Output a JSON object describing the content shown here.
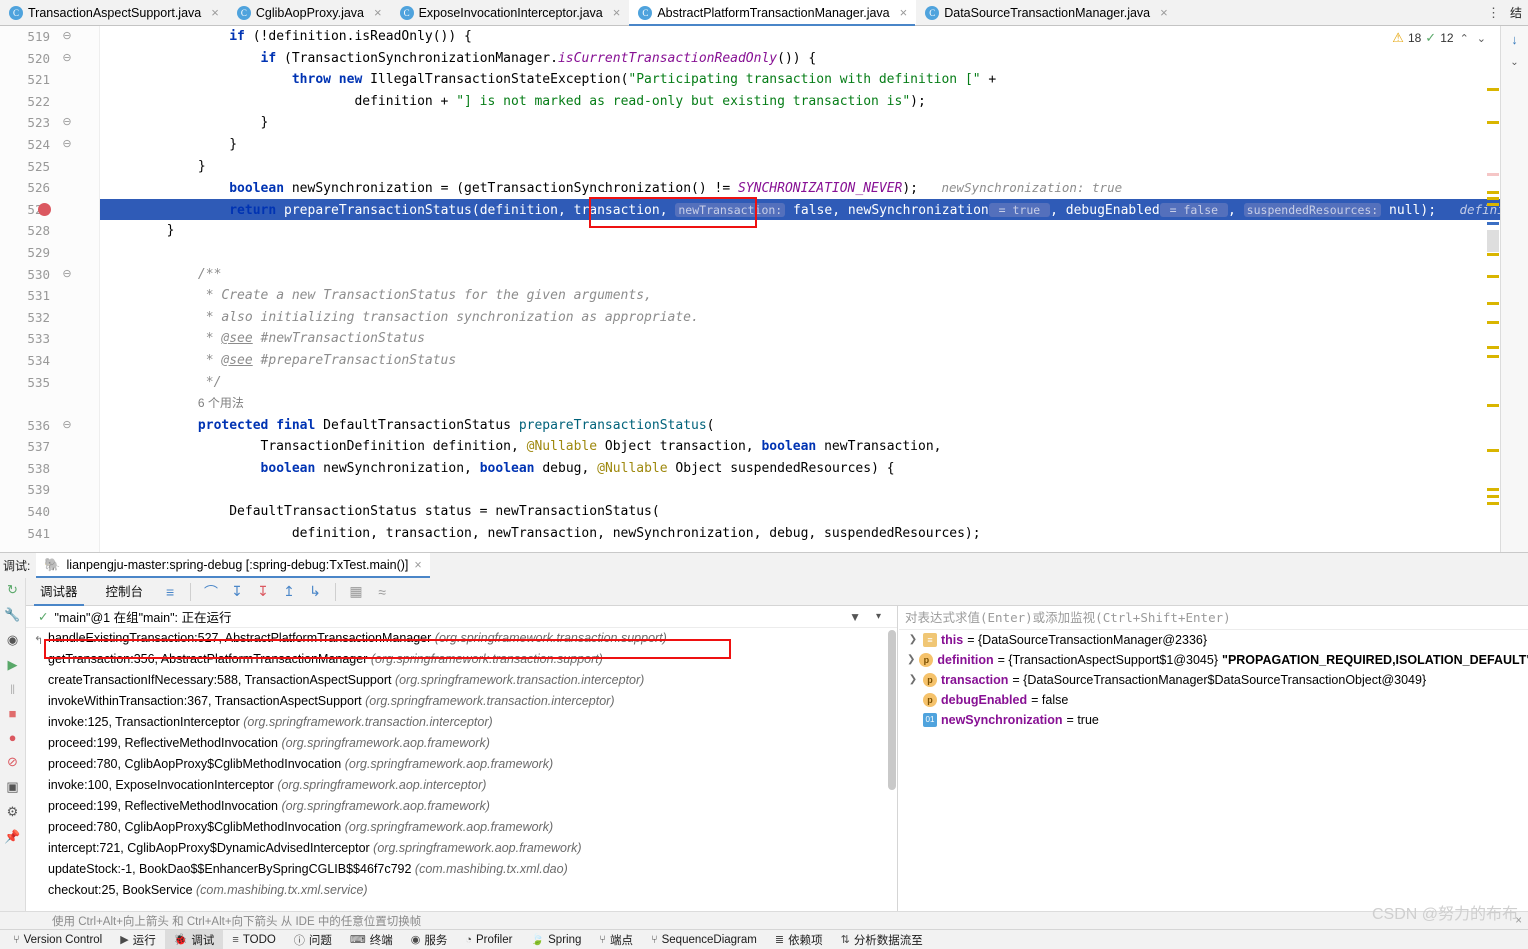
{
  "tabs": [
    {
      "label": "TransactionAspectSupport.java",
      "icon": "java-class-icon",
      "active": false,
      "closable": true
    },
    {
      "label": "CglibAopProxy.java",
      "icon": "java-class-icon",
      "active": false,
      "closable": true
    },
    {
      "label": "ExposeInvocationInterceptor.java",
      "icon": "java-class-icon",
      "active": false,
      "closable": true
    },
    {
      "label": "AbstractPlatformTransactionManager.java",
      "icon": "java-class-icon",
      "active": true,
      "closable": true
    },
    {
      "label": "DataSourceTransactionManager.java",
      "icon": "java-class-icon",
      "active": false,
      "closable": true
    }
  ],
  "tabbar": {
    "overflow_label": "⋮",
    "right_label": "结"
  },
  "inspection": {
    "warning_icon": "warning-triangle-icon",
    "warning_count": "18",
    "ok_icon": "check-icon",
    "ok_count": "12",
    "prev_label": "⌃",
    "next_label": "⌄"
  },
  "editor": {
    "first_line_number": 519,
    "lines": [
      {
        "n": "519",
        "fold": "⊖",
        "indent": 4,
        "html": "<span class=\"kw\">if</span> (!definition.isReadOnly()) {"
      },
      {
        "n": "520",
        "fold": "⊖",
        "indent": 5,
        "html": "<span class=\"kw\">if</span> (TransactionSynchronizationManager.<span class=\"stat\">isCurrentTransactionReadOnly</span>()) {"
      },
      {
        "n": "521",
        "fold": "",
        "indent": 6,
        "html": "<span class=\"kw\">throw new</span> IllegalTransactionStateException(<span class=\"str\">\"Participating transaction with definition [\"</span> +"
      },
      {
        "n": "522",
        "fold": "",
        "indent": 8,
        "html": "definition + <span class=\"str\">\"] is not marked as read-only but existing transaction is\"</span>);"
      },
      {
        "n": "523",
        "fold": "⊖",
        "indent": 5,
        "html": "}"
      },
      {
        "n": "524",
        "fold": "⊖",
        "indent": 4,
        "html": "}"
      },
      {
        "n": "525",
        "fold": "",
        "indent": 3,
        "html": "}"
      },
      {
        "n": "526",
        "fold": "",
        "indent": 4,
        "html": "<span class=\"kw\">boolean</span> newSynchronization = (getTransactionSynchronization() != <span class=\"stat\">SYNCHRONIZATION_NEVER</span>);&nbsp;&nbsp; <span class=\"inlay-val\">newSynchronization: true</span>"
      },
      {
        "n": "527",
        "fold": "",
        "indent": 4,
        "highlight": true,
        "breakpoint": true,
        "html": "<span class=\"kw\">return</span> prepareTransactionStatus(definition, transaction, <span class=\"hint\">newTransaction:</span> false, newSynchronization<span class=\"hint\">&nbsp;= true&nbsp;</span>, debugEnabled<span class=\"hint\">&nbsp;= false&nbsp;</span>, <span class=\"hint\">suspendedResources:</span> null);&nbsp;&nbsp; <span class=\"inlay-val\">definition: \"PROPAGA</span>"
      },
      {
        "n": "528",
        "fold": "",
        "indent": 2,
        "html": "}"
      },
      {
        "n": "529",
        "fold": "",
        "indent": 0,
        "html": " "
      },
      {
        "n": "530",
        "fold": "⊖",
        "indent": 3,
        "html": "<span class=\"cmt\">/**</span>"
      },
      {
        "n": "531",
        "fold": "",
        "indent": 3,
        "html": "<span class=\"cmt\"> * Create a new TransactionStatus for the given arguments,</span>"
      },
      {
        "n": "532",
        "fold": "",
        "indent": 3,
        "html": "<span class=\"cmt\"> * also initializing transaction synchronization as appropriate.</span>"
      },
      {
        "n": "533",
        "fold": "",
        "indent": 3,
        "html": "<span class=\"cmt\"> * <span style=\"text-decoration:underline\">@see</span> #newTransactionStatus</span>"
      },
      {
        "n": "534",
        "fold": "",
        "indent": 3,
        "html": "<span class=\"cmt\"> * <span style=\"text-decoration:underline\">@see</span> #prepareTransactionStatus</span>"
      },
      {
        "n": "535",
        "fold": "",
        "indent": 3,
        "html": "<span class=\"cmt\"> */</span>"
      },
      {
        "n": "",
        "fold": "",
        "indent": 3,
        "usage": true,
        "html": "<span style=\"font-family:'Liberation Sans',sans-serif;font-size:12px;color:#808080\">6 个用法</span>"
      },
      {
        "n": "536",
        "fold": "⊖",
        "indent": 3,
        "html": "<span class=\"kw\">protected final</span> DefaultTransactionStatus <span class=\"mth\">prepareTransactionStatus</span>("
      },
      {
        "n": "537",
        "fold": "",
        "indent": 5,
        "html": "TransactionDefinition definition, <span class=\"ann\">@Nullable</span> Object transaction, <span class=\"kw\">boolean</span> newTransaction,"
      },
      {
        "n": "538",
        "fold": "",
        "indent": 5,
        "html": "<span class=\"kw\">boolean</span> newSynchronization, <span class=\"kw\">boolean</span> debug, <span class=\"ann\">@Nullable</span> Object suspendedResources) {"
      },
      {
        "n": "539",
        "fold": "",
        "indent": 0,
        "html": " "
      },
      {
        "n": "540",
        "fold": "",
        "indent": 4,
        "html": "DefaultTransactionStatus status = newTransactionStatus("
      },
      {
        "n": "541",
        "fold": "",
        "indent": 6,
        "html": "definition, transaction, newTransaction, newSynchronization, debug, suspendedResources);"
      }
    ]
  },
  "debug_window": {
    "label": "调试:",
    "run_tab": {
      "icon": "gradle-elephant-icon",
      "label": "lianpengju-master:spring-debug [:spring-debug:TxTest.main()]",
      "close": "×"
    },
    "toolbar": {
      "rerun_icon": "rerun-icon",
      "tabs": [
        {
          "label": "调试器",
          "active": true
        },
        {
          "label": "控制台",
          "active": false
        }
      ],
      "buttons": [
        {
          "name": "layout-icon",
          "glyph": "≡",
          "color": "blue"
        },
        {
          "name": "step-over-icon",
          "glyph": "⌒",
          "color": "blue"
        },
        {
          "name": "step-into-icon",
          "glyph": "↓",
          "color": "blue"
        },
        {
          "name": "force-step-into-icon",
          "glyph": "↓",
          "color": "red"
        },
        {
          "name": "step-out-icon",
          "glyph": "↑",
          "color": "blue"
        },
        {
          "name": "run-to-cursor-icon",
          "glyph": "↴",
          "color": "blue"
        },
        {
          "name": "evaluate-icon",
          "glyph": "▦",
          "color": "grey"
        },
        {
          "name": "settings-icon",
          "glyph": "≈",
          "color": "grey"
        }
      ]
    },
    "left_rail": [
      {
        "name": "rerun-icon",
        "glyph": "↺"
      },
      {
        "name": "wrench-icon",
        "glyph": "🔧"
      },
      {
        "name": "eye-icon",
        "glyph": "◉"
      },
      {
        "name": "resume-icon",
        "glyph": "▶"
      },
      {
        "name": "pause-icon",
        "glyph": "‖"
      },
      {
        "name": "stop-icon",
        "glyph": "■"
      },
      {
        "name": "breakpoints-icon",
        "glyph": "●"
      },
      {
        "name": "mute-breakpoints-icon",
        "glyph": "⌀"
      },
      {
        "name": "camera-icon",
        "glyph": "▣"
      },
      {
        "name": "gear-icon",
        "glyph": "⚙"
      },
      {
        "name": "pin-icon",
        "glyph": "📌"
      }
    ],
    "thread": {
      "status_icon": "check-icon",
      "label": "\"main\"@1 在组\"main\": 正在运行",
      "filter_icon": "filter-icon",
      "dropdown_icon": "chevron-down-icon"
    },
    "frames": [
      {
        "method": "handleExistingTransaction:527, AbstractPlatformTransactionManager",
        "pkg": "(org.springframework.transaction.support)",
        "selected": true
      },
      {
        "method": "getTransaction:356, AbstractPlatformTransactionManager",
        "pkg": "(org.springframework.transaction.support)",
        "selected": false
      },
      {
        "method": "createTransactionIfNecessary:588, TransactionAspectSupport",
        "pkg": "(org.springframework.transaction.interceptor)",
        "selected": false
      },
      {
        "method": "invokeWithinTransaction:367, TransactionAspectSupport",
        "pkg": "(org.springframework.transaction.interceptor)",
        "selected": false
      },
      {
        "method": "invoke:125, TransactionInterceptor",
        "pkg": "(org.springframework.transaction.interceptor)",
        "selected": false
      },
      {
        "method": "proceed:199, ReflectiveMethodInvocation",
        "pkg": "(org.springframework.aop.framework)",
        "selected": false
      },
      {
        "method": "proceed:780, CglibAopProxy$CglibMethodInvocation",
        "pkg": "(org.springframework.aop.framework)",
        "selected": false
      },
      {
        "method": "invoke:100, ExposeInvocationInterceptor",
        "pkg": "(org.springframework.aop.interceptor)",
        "selected": false
      },
      {
        "method": "proceed:199, ReflectiveMethodInvocation",
        "pkg": "(org.springframework.aop.framework)",
        "selected": false
      },
      {
        "method": "proceed:780, CglibAopProxy$CglibMethodInvocation",
        "pkg": "(org.springframework.aop.framework)",
        "selected": false
      },
      {
        "method": "intercept:721, CglibAopProxy$DynamicAdvisedInterceptor",
        "pkg": "(org.springframework.aop.framework)",
        "selected": false
      },
      {
        "method": "updateStock:-1, BookDao$$EnhancerBySpringCGLIB$$46f7c792",
        "pkg": "(com.mashibing.tx.xml.dao)",
        "selected": false
      },
      {
        "method": "checkout:25, BookService",
        "pkg": "(com.mashibing.tx.xml.service)",
        "selected": false
      }
    ],
    "watch": {
      "placeholder": "对表达式求值(Enter)或添加监视(Ctrl+Shift+Enter)"
    },
    "variables": [
      {
        "expandable": true,
        "icon": "object-icon",
        "icon_glyph": "≡",
        "name": "this",
        "value": "= {DataSourceTransactionManager@2336}",
        "str": ""
      },
      {
        "expandable": true,
        "icon": "parameter-icon",
        "icon_glyph": "p",
        "name": "definition",
        "value": "= {TransactionAspectSupport$1@3045}",
        "str": "\"PROPAGATION_REQUIRED,ISOLATION_DEFAULT\""
      },
      {
        "expandable": true,
        "icon": "parameter-icon",
        "icon_glyph": "p",
        "name": "transaction",
        "value": "= {DataSourceTransactionManager$DataSourceTransactionObject@3049}",
        "str": ""
      },
      {
        "expandable": false,
        "icon": "parameter-icon",
        "icon_glyph": "p",
        "name": "debugEnabled",
        "value": "= false",
        "str": ""
      },
      {
        "expandable": false,
        "icon": "primitive-icon",
        "icon_glyph": "01",
        "name": "newSynchronization",
        "value": "= true",
        "str": ""
      }
    ],
    "hint_bar": {
      "text": "使用 Ctrl+Alt+向上箭头 和 Ctrl+Alt+向下箭头 从 IDE 中的任意位置切换帧",
      "close": "×"
    }
  },
  "statusbar": [
    {
      "label": "Version Control",
      "icon": "branch-icon",
      "glyph": "⑂",
      "active": false
    },
    {
      "label": "运行",
      "icon": "run-icon",
      "glyph": "▶",
      "active": false
    },
    {
      "label": "调试",
      "icon": "debug-icon",
      "glyph": "🐞",
      "active": true
    },
    {
      "label": "TODO",
      "icon": "todo-icon",
      "glyph": "≡",
      "active": false
    },
    {
      "label": "问题",
      "icon": "problems-icon",
      "glyph": "ⓘ",
      "active": false
    },
    {
      "label": "终端",
      "icon": "terminal-icon",
      "glyph": "⌨",
      "active": false
    },
    {
      "label": "服务",
      "icon": "services-icon",
      "glyph": "◉",
      "active": false
    },
    {
      "label": "Profiler",
      "icon": "profiler-icon",
      "glyph": "◔",
      "active": false
    },
    {
      "label": "Spring",
      "icon": "spring-icon",
      "glyph": "🍃",
      "active": false
    },
    {
      "label": "端点",
      "icon": "endpoints-icon",
      "glyph": "⑂",
      "active": false
    },
    {
      "label": "SequenceDiagram",
      "icon": "sequence-diagram-icon",
      "glyph": "⑂",
      "active": false
    },
    {
      "label": "依赖项",
      "icon": "dependencies-icon",
      "glyph": "≣",
      "active": false
    },
    {
      "label": "分析数据流至",
      "icon": "dataflow-icon",
      "glyph": "⇅",
      "active": false
    }
  ],
  "watermark": {
    "text": "CSDN @努力的布布"
  },
  "colors": {
    "accent": "#4a86c8",
    "selection": "#2f5bb7",
    "breakpoint": "#db5860",
    "highlight_box": "#ee1111",
    "keyword": "#0033b3",
    "string": "#067d17",
    "comment": "#8c8c8c"
  }
}
